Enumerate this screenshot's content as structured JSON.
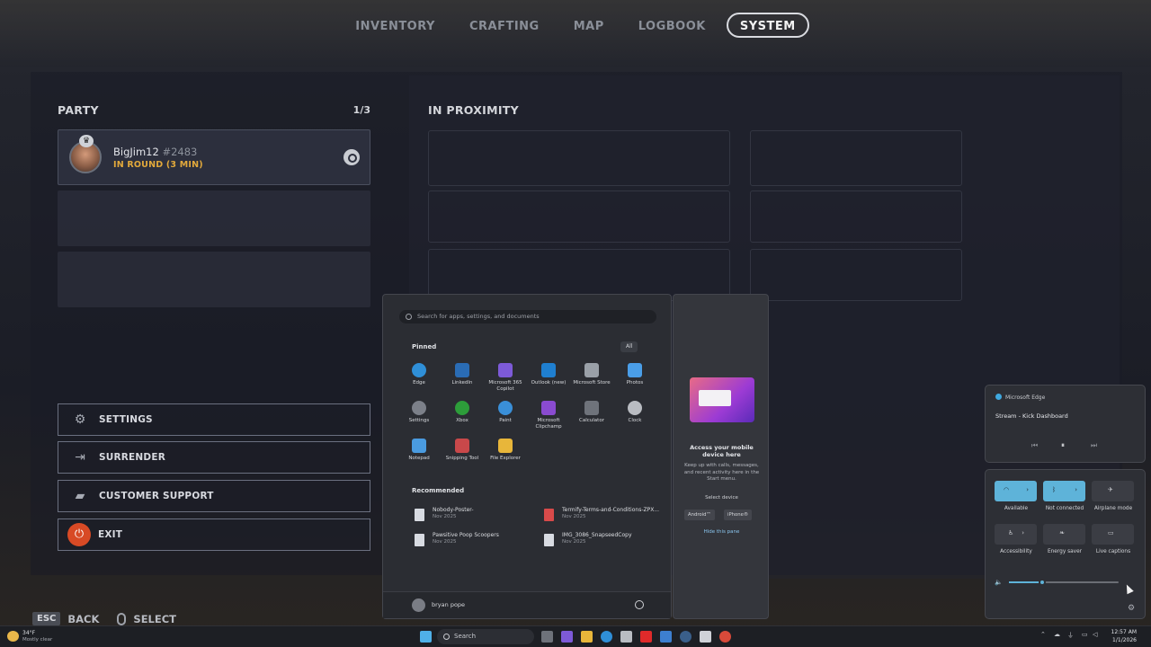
{
  "nav": {
    "tabs": [
      {
        "label": "INVENTORY"
      },
      {
        "label": "CRAFTING"
      },
      {
        "label": "MAP"
      },
      {
        "label": "LOGBOOK"
      },
      {
        "label": "SYSTEM",
        "active": true
      }
    ]
  },
  "party": {
    "title": "PARTY",
    "count": "1/3",
    "member": {
      "name": "BigJim12",
      "tag": "#2483",
      "status": "IN ROUND (3 MIN)",
      "platform_icon": "steam-icon"
    }
  },
  "proximity": {
    "title": "IN PROXIMITY"
  },
  "menu": {
    "settings": "SETTINGS",
    "surrender": "SURRENDER",
    "support": "CUSTOMER SUPPORT",
    "exit": "EXIT"
  },
  "hints": {
    "back_key": "ESC",
    "back": "BACK",
    "select": "SELECT"
  },
  "start_menu": {
    "search_placeholder": "Search for apps, settings, and documents",
    "pinned_label": "Pinned",
    "all_label": "All",
    "apps": [
      {
        "label": "Edge",
        "color": "#2f8fd8"
      },
      {
        "label": "LinkedIn",
        "color": "#2a6cb5"
      },
      {
        "label": "Microsoft 365 Copilot",
        "color": "#7d5ad8"
      },
      {
        "label": "Outlook (new)",
        "color": "#1f7fd0"
      },
      {
        "label": "Microsoft Store",
        "color": "#9aa0a8"
      },
      {
        "label": "Photos",
        "color": "#4a9ee8"
      },
      {
        "label": "Settings",
        "color": "#7c8089"
      },
      {
        "label": "Xbox",
        "color": "#2d9d3a"
      },
      {
        "label": "Paint",
        "color": "#3a8fd8"
      },
      {
        "label": "Microsoft Clipchamp",
        "color": "#8a4bd0"
      },
      {
        "label": "Calculator",
        "color": "#6f737b"
      },
      {
        "label": "Clock",
        "color": "#b9bcc2"
      },
      {
        "label": "Notepad",
        "color": "#4a9be0"
      },
      {
        "label": "Snipping Tool",
        "color": "#c9484a"
      },
      {
        "label": "File Explorer",
        "color": "#e8b63a"
      }
    ],
    "recommended_label": "Recommended",
    "recommended": [
      {
        "name": "Nobody-Poster-",
        "date": "Nov 2025"
      },
      {
        "name": "Termify-Terms-and-Conditions-ZPX...",
        "date": "Nov 2025"
      },
      {
        "name": "Pawsitive Poop Scoopers",
        "date": "Nov 2025"
      },
      {
        "name": "IMG_3086_SnapseedCopy",
        "date": "Nov 2025"
      }
    ],
    "user": "bryan pope"
  },
  "phone_pane": {
    "title": "Access your mobile device here",
    "desc": "Keep up with calls, messages, and recent activity here in the Start menu.",
    "select": "Select device",
    "android": "Android™",
    "iphone": "iPhone®",
    "hide": "Hide this pane"
  },
  "media": {
    "app": "Microsoft Edge",
    "title": "Stream - Kick Dashboard"
  },
  "quick_settings": {
    "tiles": [
      {
        "label": "Available",
        "state": "on"
      },
      {
        "label": "Not connected",
        "state": "on"
      },
      {
        "label": "Airplane mode",
        "state": "off"
      },
      {
        "label": "Accessibility",
        "state": "off"
      },
      {
        "label": "Energy saver",
        "state": "off"
      },
      {
        "label": "Live captions",
        "state": "off"
      }
    ],
    "volume": 0.3
  },
  "taskbar": {
    "temp": "34°F",
    "weather": "Mostly clear",
    "search": "Search",
    "time": "12:57 AM",
    "date": "1/1/2026"
  }
}
